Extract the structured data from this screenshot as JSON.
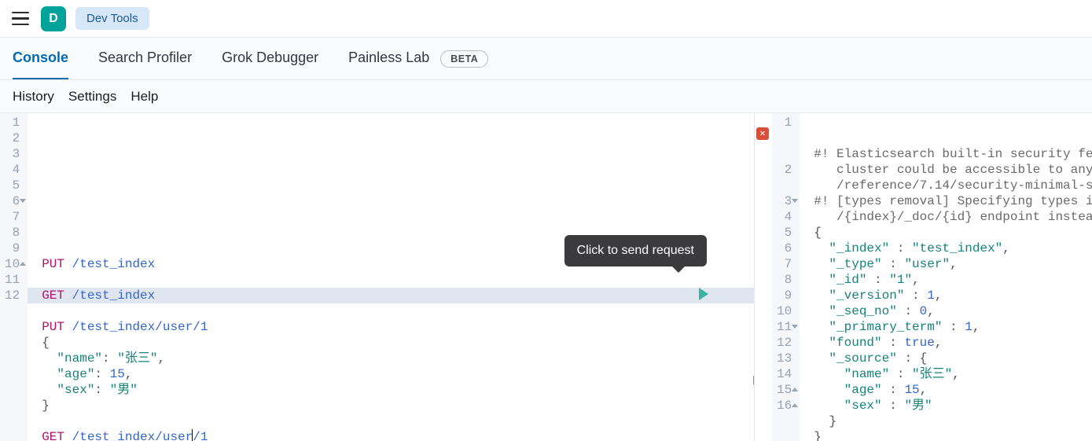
{
  "header": {
    "logo_letter": "D",
    "breadcrumb": "Dev Tools"
  },
  "tabs": [
    {
      "label": "Console",
      "active": true
    },
    {
      "label": "Search Profiler",
      "active": false
    },
    {
      "label": "Grok Debugger",
      "active": false
    },
    {
      "label": "Painless Lab",
      "active": false
    }
  ],
  "beta_badge": "BETA",
  "subnav": {
    "history": "History",
    "settings": "Settings",
    "help": "Help"
  },
  "tooltip": "Click to send request",
  "left_editor": {
    "lines": [
      {
        "n": "1",
        "method": "PUT",
        "path": "/test_index"
      },
      {
        "n": "2",
        "blank": true
      },
      {
        "n": "3",
        "method": "GET",
        "path": "/test_index"
      },
      {
        "n": "4",
        "blank": true
      },
      {
        "n": "5",
        "method": "PUT",
        "path": "/test_index/user/1"
      },
      {
        "n": "6",
        "raw_open": "{",
        "fold": "down"
      },
      {
        "n": "7",
        "key": "name",
        "str": "张三",
        "comma": ","
      },
      {
        "n": "8",
        "key": "age",
        "num": "15",
        "comma": ","
      },
      {
        "n": "9",
        "key": "sex",
        "str": "男"
      },
      {
        "n": "10",
        "raw_close": "}",
        "fold": "up"
      },
      {
        "n": "11",
        "blank": true
      },
      {
        "n": "12",
        "method": "GET",
        "path_a": "/test_index/user",
        "path_b": "/1",
        "highlight": true,
        "cursor": true
      }
    ]
  },
  "right_editor": {
    "warn1a": "#! Elasticsearch built-in security fe",
    "warn1b": "cluster could be accessible to anyo",
    "warn1c": "/reference/7.14/security-minimal-se",
    "warn2a": "#! [types removal] Specifying types i",
    "warn2b": "/{index}/_doc/{id} endpoint instead",
    "lines": [
      {
        "n": "1"
      },
      {
        "n": ""
      },
      {
        "n": ""
      },
      {
        "n": "2"
      },
      {
        "n": ""
      },
      {
        "n": "3",
        "fold": "down"
      },
      {
        "n": "4"
      },
      {
        "n": "5"
      },
      {
        "n": "6"
      },
      {
        "n": "7"
      },
      {
        "n": "8"
      },
      {
        "n": "9"
      },
      {
        "n": "10"
      },
      {
        "n": "11",
        "fold": "down"
      },
      {
        "n": "12"
      },
      {
        "n": "13"
      },
      {
        "n": "14"
      },
      {
        "n": "15",
        "fold": "up"
      },
      {
        "n": "16",
        "fold": "up"
      }
    ],
    "body": {
      "open": "{",
      "index_k": "\"_index\"",
      "index_v": "\"test_index\"",
      "type_k": "\"_type\"",
      "type_v": "\"user\"",
      "id_k": "\"_id\"",
      "id_v": "\"1\"",
      "version_k": "\"_version\"",
      "version_v": "1",
      "seq_k": "\"_seq_no\"",
      "seq_v": "0",
      "pt_k": "\"_primary_term\"",
      "pt_v": "1",
      "found_k": "\"found\"",
      "found_v": "true",
      "source_k": "\"_source\"",
      "name_k": "\"name\"",
      "name_v": "\"张三\"",
      "age_k": "\"age\"",
      "age_v": "15",
      "sex_k": "\"sex\"",
      "sex_v": "\"男\"",
      "close": "}"
    }
  }
}
